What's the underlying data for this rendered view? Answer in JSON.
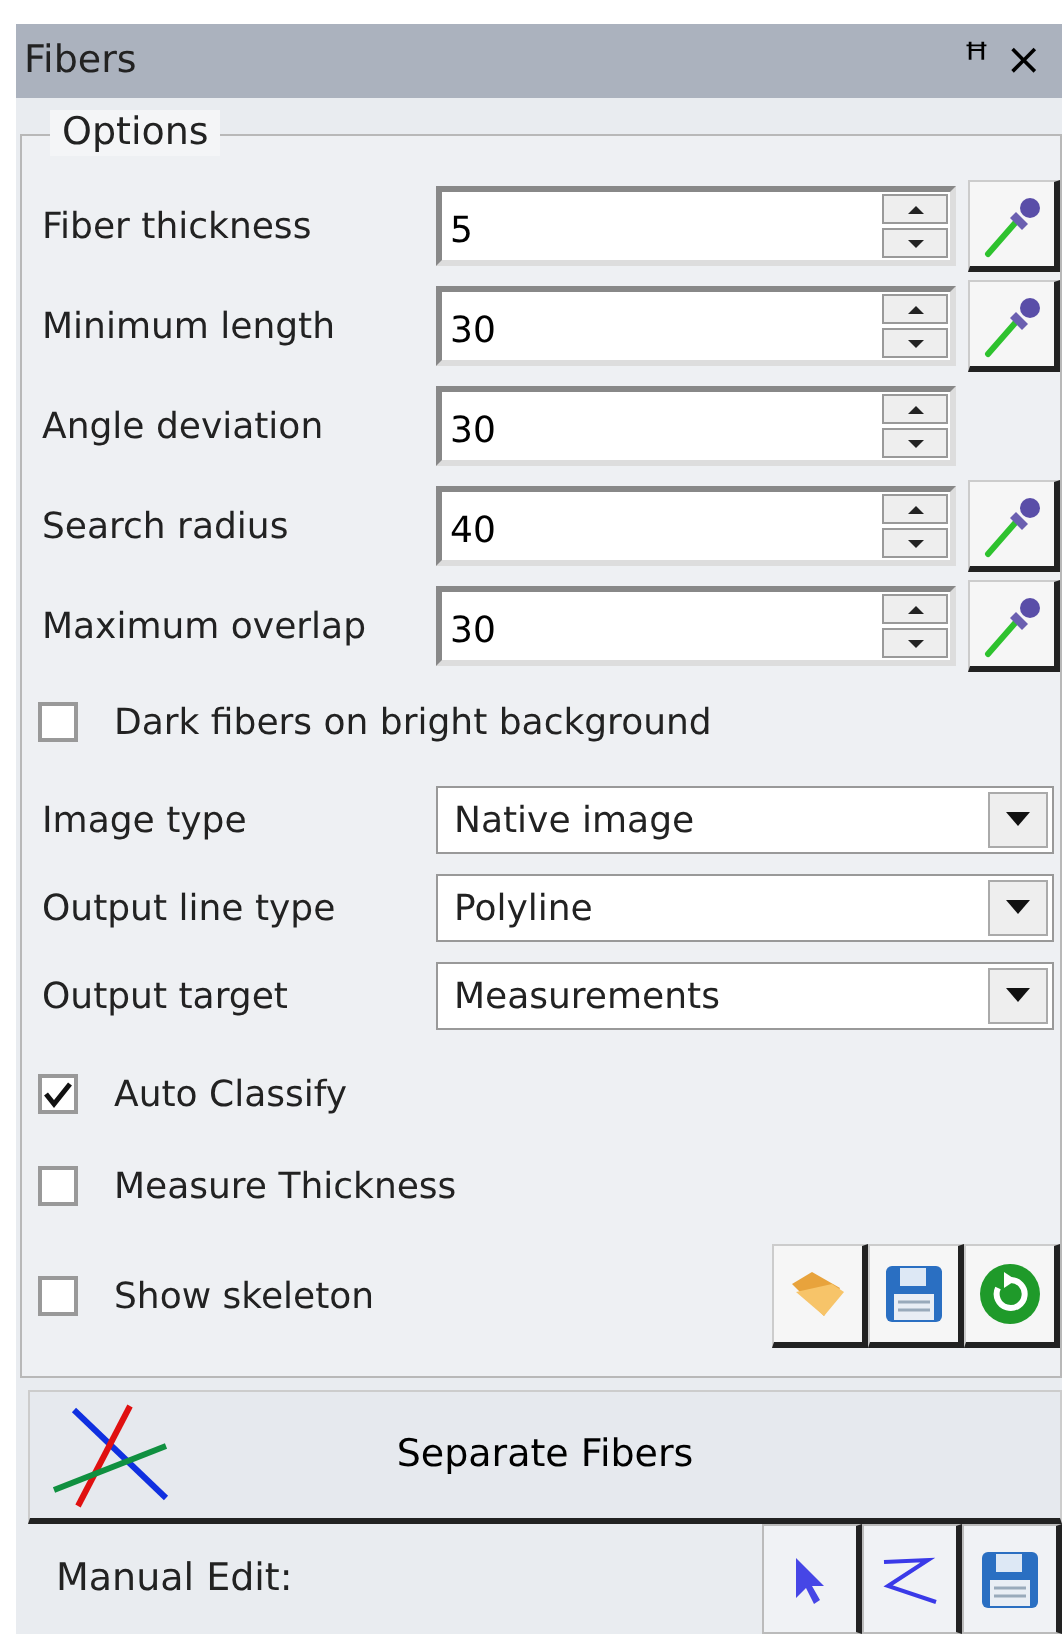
{
  "window": {
    "title": "Fibers",
    "pin": "ꟸ",
    "close": "×"
  },
  "options": {
    "legend": "Options",
    "parameters": [
      {
        "label": "Fiber thickness",
        "value": "5",
        "picker": true
      },
      {
        "label": "Minimum length",
        "value": "30",
        "picker": true
      },
      {
        "label": "Angle deviation",
        "value": "30",
        "picker": false
      },
      {
        "label": "Search radius",
        "value": "40",
        "picker": true
      },
      {
        "label": "Maximum overlap",
        "value": "30",
        "picker": true
      }
    ],
    "dark_fibers": {
      "label": "Dark fibers on bright background",
      "checked": false
    },
    "dropdowns": [
      {
        "label": "Image type",
        "value": "Native image"
      },
      {
        "label": "Output line type",
        "value": "Polyline"
      },
      {
        "label": "Output target",
        "value": "Measurements"
      }
    ],
    "checks": [
      {
        "label": "Auto Classify",
        "checked": true
      },
      {
        "label": "Measure Thickness",
        "checked": false
      },
      {
        "label": "Show skeleton",
        "checked": false
      }
    ]
  },
  "separate_button": {
    "label": "Separate Fibers"
  },
  "manual_edit": {
    "label": "Manual Edit:"
  }
}
